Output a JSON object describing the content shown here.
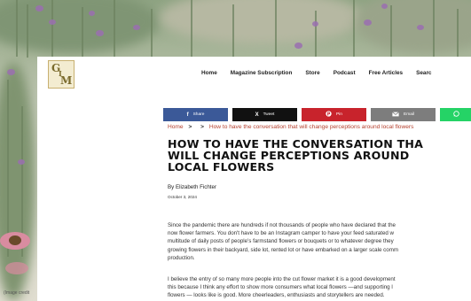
{
  "background": {
    "credit": "(Image credit"
  },
  "header": {
    "logo": {
      "g": "G",
      "i": "I",
      "m": "M"
    },
    "nav": [
      "Home",
      "Magazine Subscription",
      "Store",
      "Podcast",
      "Free Articles",
      "Searc"
    ]
  },
  "share": {
    "facebook": "Share",
    "twitter": "Tweet",
    "pinterest": "Pin",
    "email": "Email",
    "twitter_icon": "X",
    "facebook_icon": "f"
  },
  "breadcrumb": {
    "home": "Home",
    "sep": ">",
    "current": "How to have the conversation that will change perceptions around local flowers"
  },
  "article": {
    "title_lines": [
      "HOW TO HAVE THE CONVERSATION THA",
      "WILL CHANGE PERCEPTIONS AROUND",
      "LOCAL FLOWERS"
    ],
    "byline": "By Elizabeth Fichter",
    "date": "October 3, 2024",
    "p1": [
      "Since the pandemic there are hundreds if not thousands of people who have declared that the",
      "now flower farmers. You don't have to be an Instagram camper to have your feed saturated w",
      "multitude of daily posts of people's farmstand flowers or bouquets or to whatever degree they",
      "growing flowers in their backyard, side lot, rented lot or have embarked on a larger scale comm",
      "production."
    ],
    "p2": [
      "I believe the entry of so many more people into the cut flower market it is a good development",
      "this because I think any effort to show more consumers what local flowers —and supporting l",
      "flowers — looks like is good. More cheerleaders, enthusiasts and storytellers are needed."
    ]
  },
  "colors": {
    "facebook": "#3b5998",
    "twitter": "#111111",
    "pinterest": "#c8232c",
    "email": "#7d7d7d",
    "whatsapp": "#25d366",
    "link": "#b5412f"
  }
}
